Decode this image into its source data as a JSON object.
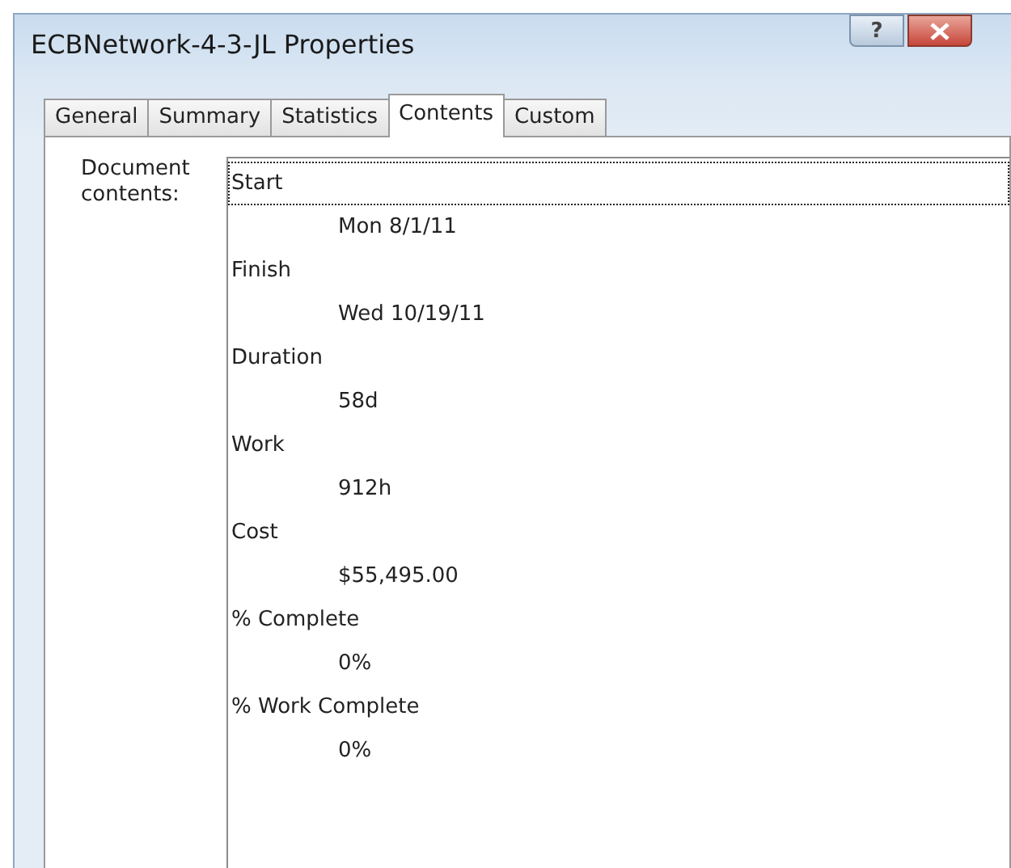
{
  "window": {
    "title": "ECBNetwork-4-3-JL Properties",
    "help_button": "?"
  },
  "tabs": [
    {
      "label": "General",
      "selected": false
    },
    {
      "label": "Summary",
      "selected": false
    },
    {
      "label": "Statistics",
      "selected": false
    },
    {
      "label": "Contents",
      "selected": true
    },
    {
      "label": "Custom",
      "selected": false
    }
  ],
  "contents_label": "Document contents:",
  "contents": [
    {
      "name": "Start",
      "value": "Mon 8/1/11",
      "focused": true
    },
    {
      "name": "Finish",
      "value": "Wed 10/19/11",
      "focused": false
    },
    {
      "name": "Duration",
      "value": "58d",
      "focused": false
    },
    {
      "name": "Work",
      "value": "912h",
      "focused": false
    },
    {
      "name": "Cost",
      "value": "$55,495.00",
      "focused": false
    },
    {
      "name": "% Complete",
      "value": "0%",
      "focused": false
    },
    {
      "name": "% Work Complete",
      "value": "0%",
      "focused": false
    }
  ]
}
